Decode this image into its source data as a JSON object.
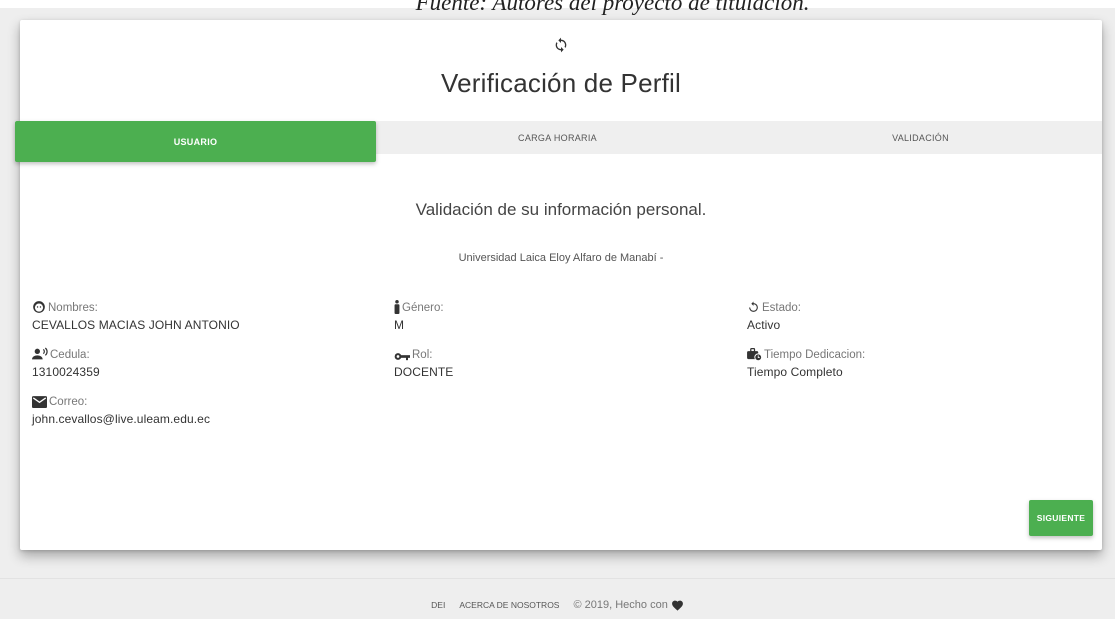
{
  "caption": "Fuente: Autores del proyecto de titulación.",
  "header": {
    "refresh_icon": "refresh-icon",
    "title": "Verificación de Perfil"
  },
  "tabs": [
    {
      "label": "USUARIO",
      "active": true
    },
    {
      "label": "CARGA HORARIA",
      "active": false
    },
    {
      "label": "VALIDACIÓN",
      "active": false
    }
  ],
  "main": {
    "subtitle": "Validación de su información personal.",
    "institution": "Universidad Laica Eloy Alfaro de Manabí -"
  },
  "fields": {
    "nombres": {
      "label": "Nombres:",
      "value": "CEVALLOS MACIAS JOHN ANTONIO",
      "icon": "face-icon"
    },
    "cedula": {
      "label": "Cedula:",
      "value": "1310024359",
      "icon": "recent-actors-icon"
    },
    "correo": {
      "label": "Correo:",
      "value": "john.cevallos@live.uleam.edu.ec",
      "icon": "email-icon"
    },
    "genero": {
      "label": "Género:",
      "value": "M",
      "icon": "person-icon"
    },
    "rol": {
      "label": "Rol:",
      "value": "DOCENTE",
      "icon": "key-icon"
    },
    "estado": {
      "label": "Estado:",
      "value": "Activo",
      "icon": "refresh-icon"
    },
    "tiempo": {
      "label": "Tiempo Dedicacion:",
      "value": "Tiempo Completo",
      "icon": "work-time-icon"
    }
  },
  "actions": {
    "next_label": "SIGUIENTE"
  },
  "footer": {
    "link_dei": "DEI",
    "link_about": "ACERCA DE NOSOTROS",
    "copyright": "© 2019, Hecho con",
    "heart_icon": "heart-icon"
  },
  "colors": {
    "accent": "#4caf50",
    "background": "#eeeeee",
    "card": "#ffffff"
  }
}
